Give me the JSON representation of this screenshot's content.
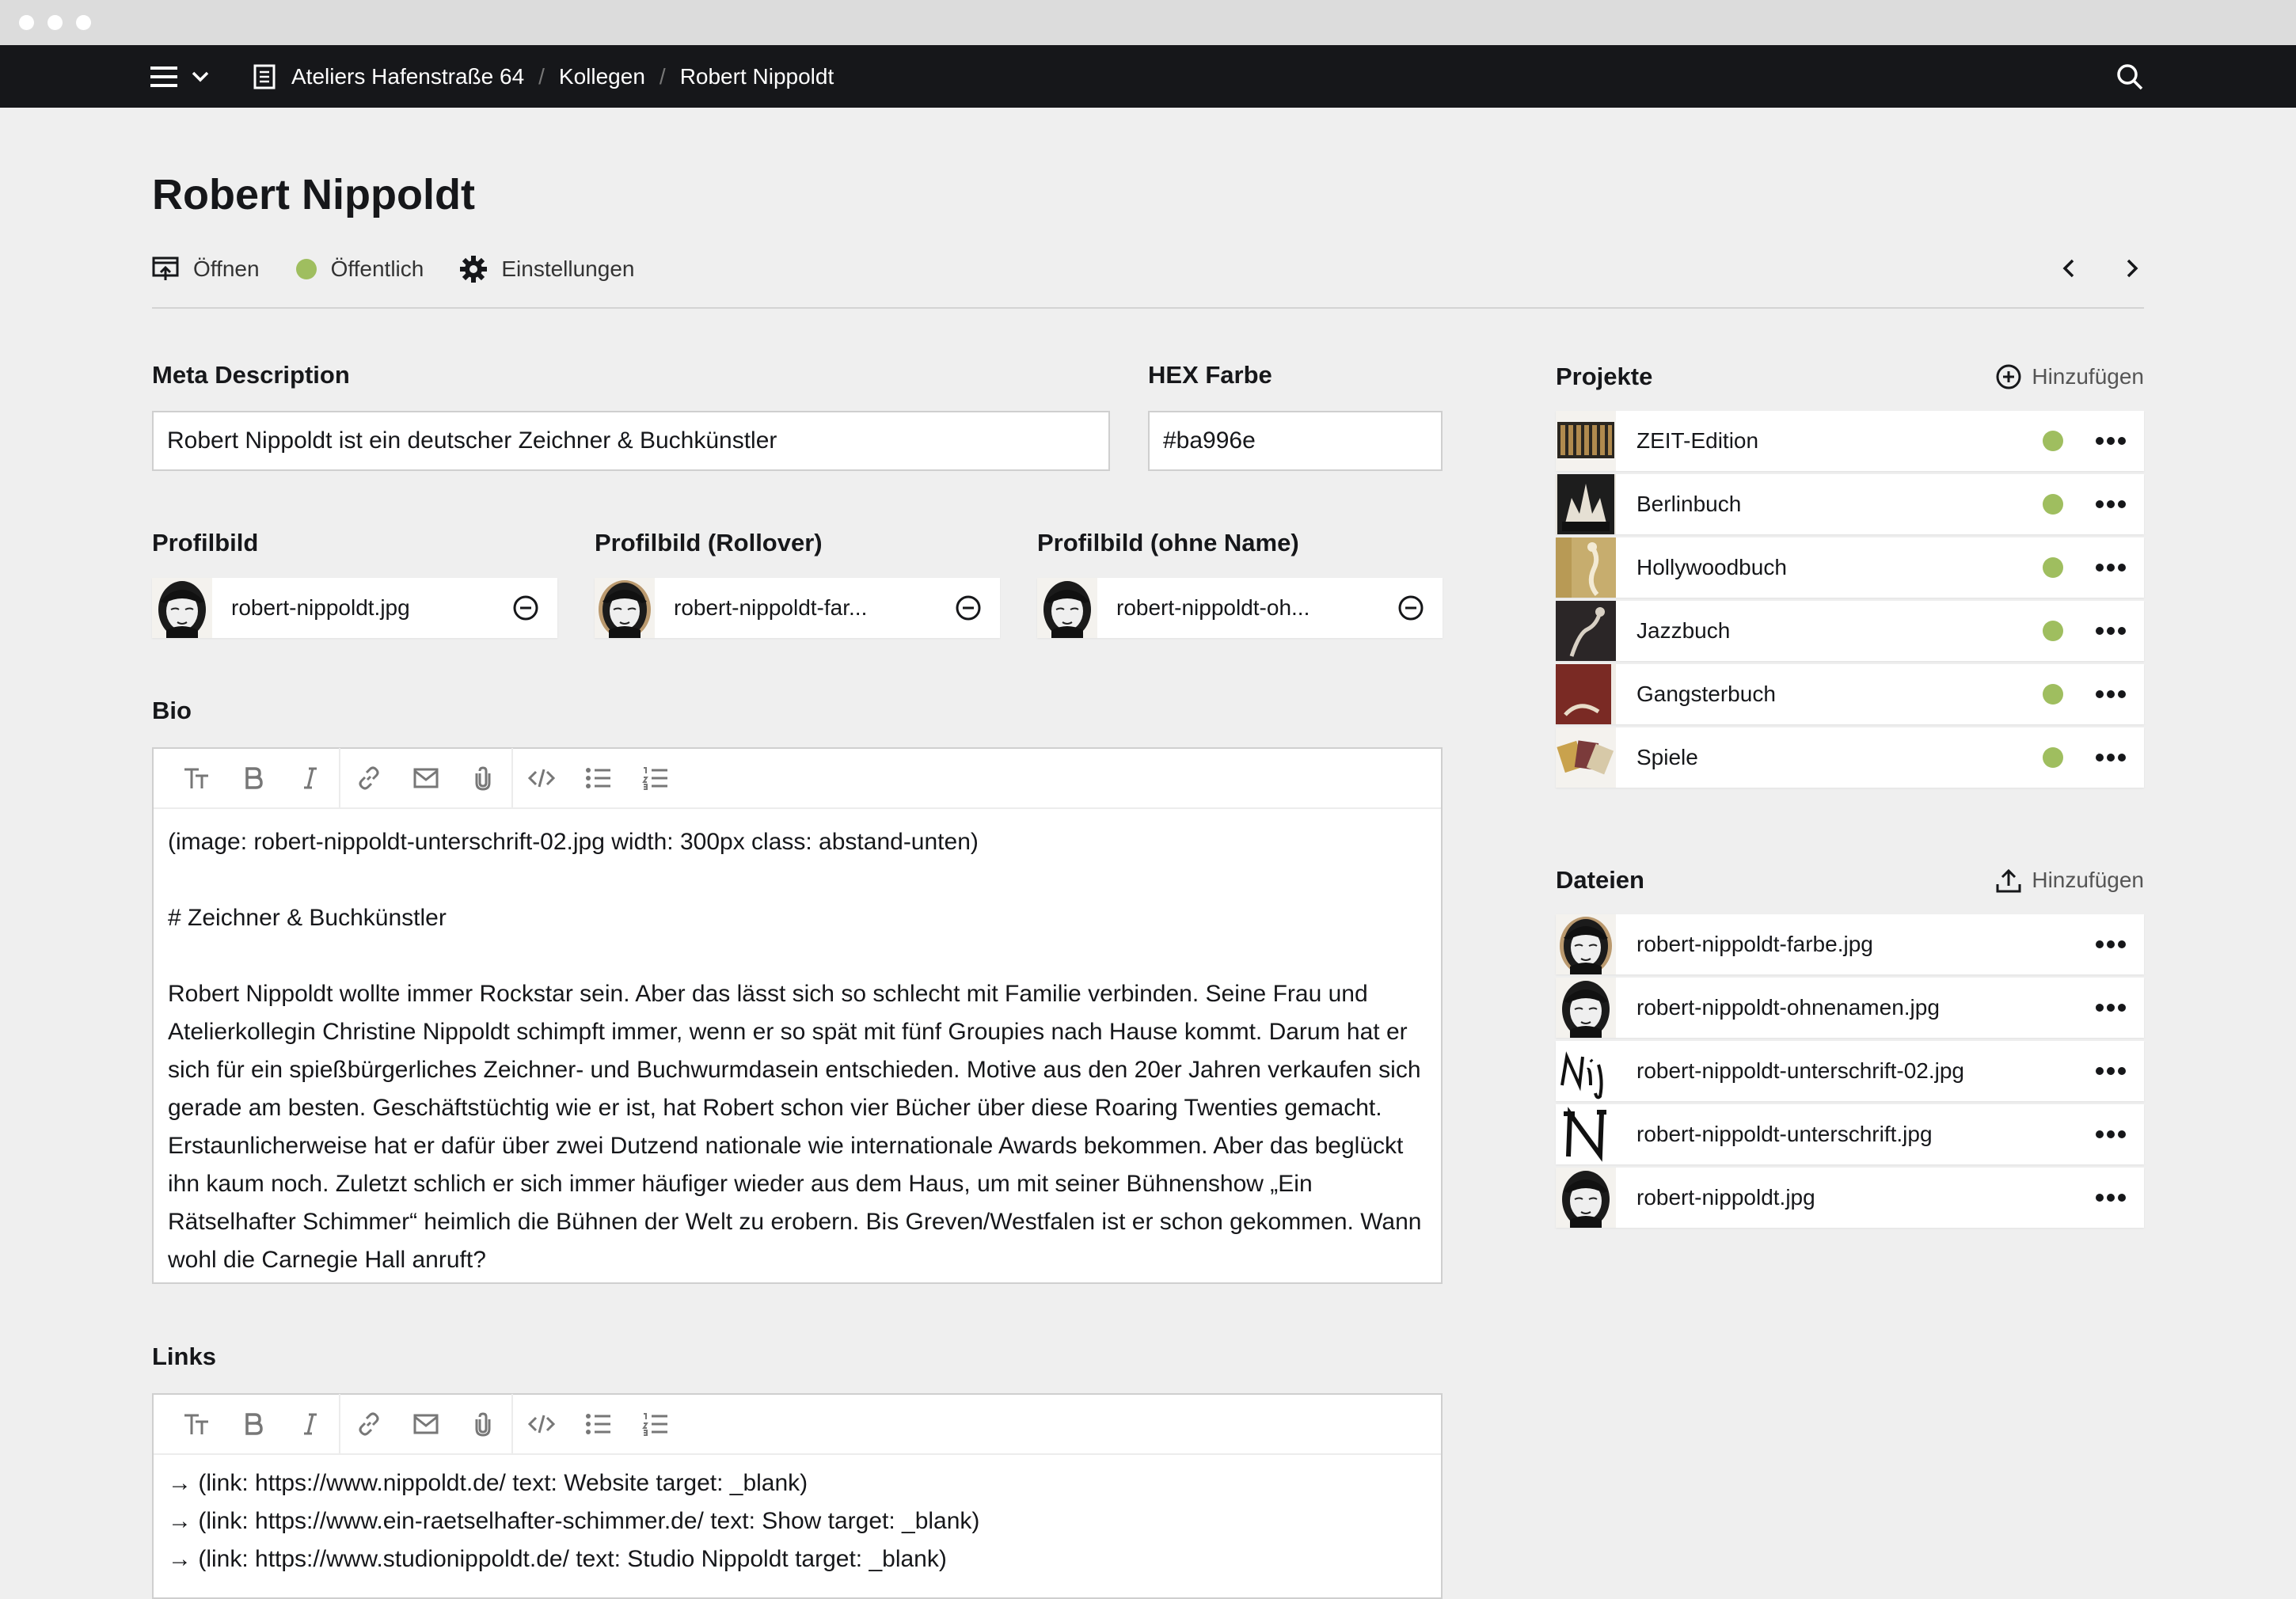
{
  "window": {
    "traffic_lights": [
      "close",
      "minimize",
      "zoom"
    ]
  },
  "topbar": {
    "breadcrumbs": [
      {
        "label": "Ateliers Hafenstraße 64"
      },
      {
        "label": "Kollegen"
      },
      {
        "label": "Robert Nippoldt"
      }
    ],
    "separator": "/",
    "icons": [
      "hamburger-menu-icon",
      "chevron-down-icon",
      "page-icon",
      "search-icon"
    ]
  },
  "page": {
    "title": "Robert Nippoldt",
    "actions": {
      "open_label": "Öffnen",
      "status_label": "Öffentlich",
      "status_color": "#9fbe5f",
      "settings_label": "Einstellungen"
    }
  },
  "fields": {
    "meta_description": {
      "label": "Meta Description",
      "value": "Robert Nippoldt ist ein deutscher Zeichner & Buchkünstler"
    },
    "hex_color": {
      "label": "HEX Farbe",
      "value": "#ba996e"
    },
    "profilbild": {
      "label": "Profilbild",
      "file": "robert-nippoldt.jpg"
    },
    "profilbild_rollover": {
      "label": "Profilbild (Rollover)",
      "file": "robert-nippoldt-far..."
    },
    "profilbild_ohne_name": {
      "label": "Profilbild (ohne Name)",
      "file": "robert-nippoldt-oh..."
    },
    "bio": {
      "label": "Bio",
      "paragraphs": [
        "(image: robert-nippoldt-unterschrift-02.jpg width: 300px class: abstand-unten)",
        "# Zeichner & Buchkünstler",
        "Robert Nippoldt wollte immer Rockstar sein. Aber das lässt sich so schlecht mit Familie verbinden. Seine Frau und Atelierkollegin Christine Nippoldt schimpft immer, wenn er so spät mit fünf Groupies nach Hause kommt. Darum hat er sich für ein spießbürgerliches Zeichner- und Buchwurmdasein entschieden. Motive aus den 20er Jahren verkaufen sich gerade am besten. Geschäftstüchtig wie er ist, hat Robert schon vier Bücher über diese Roaring Twenties gemacht. Erstaunlicherweise hat er dafür über zwei Dutzend nationale wie internationale Awards bekommen. Aber das beglückt ihn kaum noch. Zuletzt schlich er sich immer häufiger wieder aus dem Haus, um mit seiner Bühnenshow „Ein Rätselhafter Schimmer“ heimlich die Bühnen der Welt zu erobern. Bis Greven/Westfalen ist er schon gekommen. Wann wohl die Carnegie Hall anruft?"
      ]
    },
    "links": {
      "label": "Links",
      "lines": [
        "→ (link: https://www.nippoldt.de/ text: Website target: _blank)",
        "→ (link: https://www.ein-raetselhafter-schimmer.de/ text: Show target: _blank)",
        "→ (link: https://www.studionippoldt.de/ text: Studio Nippoldt target: _blank)"
      ]
    }
  },
  "editor_toolbar": [
    "heading-icon",
    "bold-icon",
    "italic-icon",
    "link-icon",
    "email-icon",
    "attachment-icon",
    "code-icon",
    "bullet-list-icon",
    "ordered-list-icon"
  ],
  "projekte": {
    "title": "Projekte",
    "add_label": "Hinzufügen",
    "items": [
      {
        "name": "ZEIT-Edition"
      },
      {
        "name": "Berlinbuch"
      },
      {
        "name": "Hollywoodbuch"
      },
      {
        "name": "Jazzbuch"
      },
      {
        "name": "Gangsterbuch"
      },
      {
        "name": "Spiele"
      }
    ]
  },
  "dateien": {
    "title": "Dateien",
    "add_label": "Hinzufügen",
    "items": [
      {
        "name": "robert-nippoldt-farbe.jpg"
      },
      {
        "name": "robert-nippoldt-ohnenamen.jpg"
      },
      {
        "name": "robert-nippoldt-unterschrift-02.jpg"
      },
      {
        "name": "robert-nippoldt-unterschrift.jpg"
      },
      {
        "name": "robert-nippoldt.jpg"
      }
    ]
  },
  "colors": {
    "topbar": "#16171a",
    "background": "#efefef",
    "published": "#9fbe5f",
    "accent_gold": "#ba996e"
  }
}
